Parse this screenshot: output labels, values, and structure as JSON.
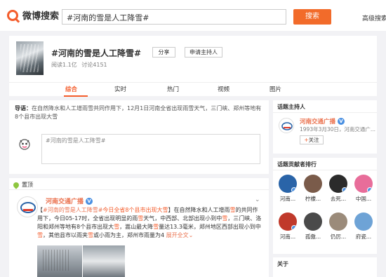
{
  "header": {
    "logo_text": "微博搜索",
    "search_value": "#河南的雪是人工降雪#",
    "search_button": "搜索",
    "advanced_search": "高级搜索"
  },
  "topic": {
    "title": "#河南的雪是人工降雪#",
    "share_label": "分享",
    "apply_host_label": "申请主持人",
    "reads": "阅读1.1亿",
    "discussions": "讨论4151"
  },
  "tabs": [
    "综合",
    "实时",
    "热门",
    "视频",
    "图片"
  ],
  "active_tab": 0,
  "guide": {
    "label": "导语：",
    "text": "在自然降水和人工增雨雪共同作用下，12月1日河南全省出现雨雪天气，三门峡、郑州等地有8个县市出现大雪"
  },
  "composer": {
    "placeholder": "#河南的雪是人工降雪#"
  },
  "pinned": {
    "label": "置顶",
    "author": "河南交通广播",
    "verified": "V",
    "chevron": "⌄",
    "body": [
      {
        "t": "【",
        "c": ""
      },
      {
        "t": "#河南的雪是人工降雪#",
        "c": "lk"
      },
      {
        "t": "今日全省8个县市出现大",
        "c": "hl"
      },
      {
        "t": "雪",
        "c": "hl"
      },
      {
        "t": "】在自然降水和人工增雨",
        "c": ""
      },
      {
        "t": "雪",
        "c": "hl"
      },
      {
        "t": "的共同作用下，今日05-17时，全省出现明显的雨",
        "c": ""
      },
      {
        "t": "雪",
        "c": "hl"
      },
      {
        "t": "天气，中西部、北部出现小到中",
        "c": ""
      },
      {
        "t": "雪",
        "c": "hl"
      },
      {
        "t": "，三门峡、洛阳和郑州等地有8个县市出现大",
        "c": ""
      },
      {
        "t": "雪",
        "c": "hl"
      },
      {
        "t": "，嵩山最大降",
        "c": ""
      },
      {
        "t": "雪",
        "c": "hl"
      },
      {
        "t": "量达13.3毫米，郑州地区西部出现小到中",
        "c": ""
      },
      {
        "t": "雪",
        "c": "hl"
      },
      {
        "t": "，其他县市以雨夹",
        "c": ""
      },
      {
        "t": "雪",
        "c": "hl"
      },
      {
        "t": "或小雨为主，郑州市雨量为4 ",
        "c": ""
      },
      {
        "t": "展开全文⌄",
        "c": "lk"
      }
    ]
  },
  "host_panel": {
    "heading": "话题主持人",
    "name": "河南交通广播",
    "verified": "V",
    "info": "1993年3月30日，河南交通广...",
    "follow_plus": "+",
    "follow_label": "关注"
  },
  "contrib_panel": {
    "heading": "话题贡献者排行",
    "items": [
      {
        "name": "河南...",
        "color": "#2a64a8",
        "verified": true
      },
      {
        "name": "柠檬...",
        "color": "#7a5b4a",
        "verified": false
      },
      {
        "name": "去死...",
        "color": "#2b2b2b",
        "verified": true
      },
      {
        "name": "中国...",
        "color": "#e86d9a",
        "verified": true
      },
      {
        "name": "河南...",
        "color": "#c0392b",
        "verified": true
      },
      {
        "name": "孤傲...",
        "color": "#4a4a4a",
        "verified": false
      },
      {
        "name": "仍厉...",
        "color": "#9b8b7a",
        "verified": false
      },
      {
        "name": "府瓷...",
        "color": "#6ea3d6",
        "verified": false
      }
    ]
  },
  "about_panel": {
    "heading": "关于"
  }
}
